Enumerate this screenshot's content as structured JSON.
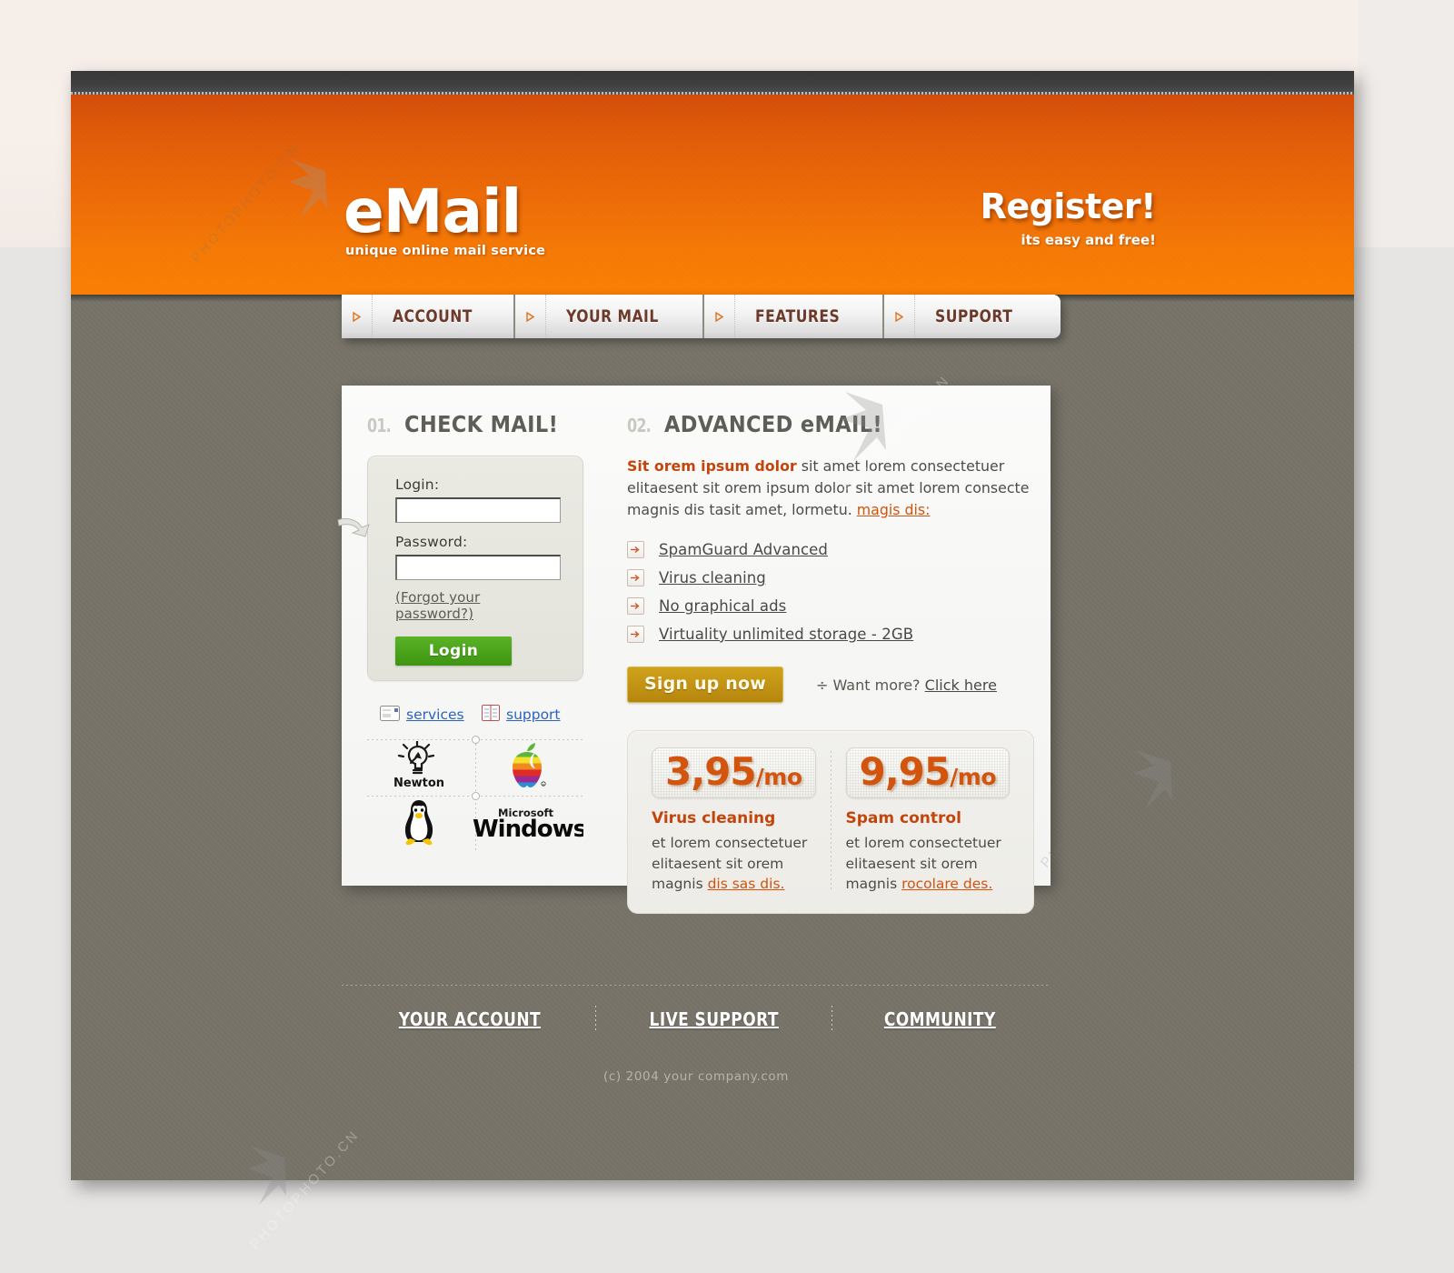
{
  "header": {
    "logo_title": "eMail",
    "logo_subtitle": "unique online mail service",
    "register_title": "Register!",
    "register_subtitle": "its easy and free!",
    "accent_orange": "#ec6a07",
    "dark_bar": "#3f3f3f"
  },
  "nav": {
    "items": [
      {
        "label": "ACCOUNT"
      },
      {
        "label": "YOUR MAIL"
      },
      {
        "label": "FEATURES"
      },
      {
        "label": "SUPPORT"
      }
    ]
  },
  "left_panel": {
    "section_number": "01.",
    "section_title": "CHECK MAIL!",
    "login_label": "Login:",
    "login_value": "",
    "login_placeholder": "",
    "password_label": "Password:",
    "password_value": "",
    "password_placeholder": "",
    "forgot_link": "(Forgot your password?)",
    "login_button": "Login",
    "quick_links": [
      {
        "label": "services",
        "icon": "card-icon"
      },
      {
        "label": "support",
        "icon": "book-icon"
      }
    ],
    "logos": [
      {
        "name": "newton-logo",
        "label": "Newton"
      },
      {
        "name": "apple-logo",
        "label": "Apple"
      },
      {
        "name": "linux-logo",
        "label": "Linux"
      },
      {
        "name": "windows-logo",
        "label": "Microsoft Windows"
      }
    ]
  },
  "right_panel": {
    "section_number": "02.",
    "section_title": "ADVANCED eMAIL!",
    "lead_bold": "Sit orem ipsum dolor",
    "lead_rest": " sit amet lorem consectetuer elitaesent sit orem ipsum dolor sit amet lorem consecte magnis dis tasit amet, lormetu. ",
    "lead_link": "magis dis:",
    "features": [
      {
        "label": "SpamGuard Advanced"
      },
      {
        "label": "Virus cleaning"
      },
      {
        "label": "No graphical ads"
      },
      {
        "label": "Virtuality unlimited storage - 2GB"
      }
    ],
    "signup_button": "Sign up now",
    "want_more_prefix": "÷ Want more? ",
    "want_more_link": "Click here",
    "pricing": [
      {
        "amount": "3,95",
        "period": "/mo",
        "name": "Virus cleaning",
        "desc": "et lorem consectetuer elitaesent sit orem magnis ",
        "desc_link": "dis sas dis."
      },
      {
        "amount": "9,95",
        "period": "/mo",
        "name": "Spam control",
        "desc": "et lorem consectetuer elitaesent sit orem magnis ",
        "desc_link": "rocolare des."
      }
    ]
  },
  "footer": {
    "links": [
      {
        "label": "YOUR ACCOUNT"
      },
      {
        "label": "LIVE SUPPORT"
      },
      {
        "label": "COMMUNITY"
      }
    ],
    "copyright": "(c) 2004 your company.com"
  },
  "watermark": {
    "text_1": "PHOTOPHOTO.CN",
    "text_2": "PHOTOPHOTO.CN",
    "text_3": "PHOTOPHOTO.CN",
    "text_4": "PHOTOPHOTO.CN"
  }
}
